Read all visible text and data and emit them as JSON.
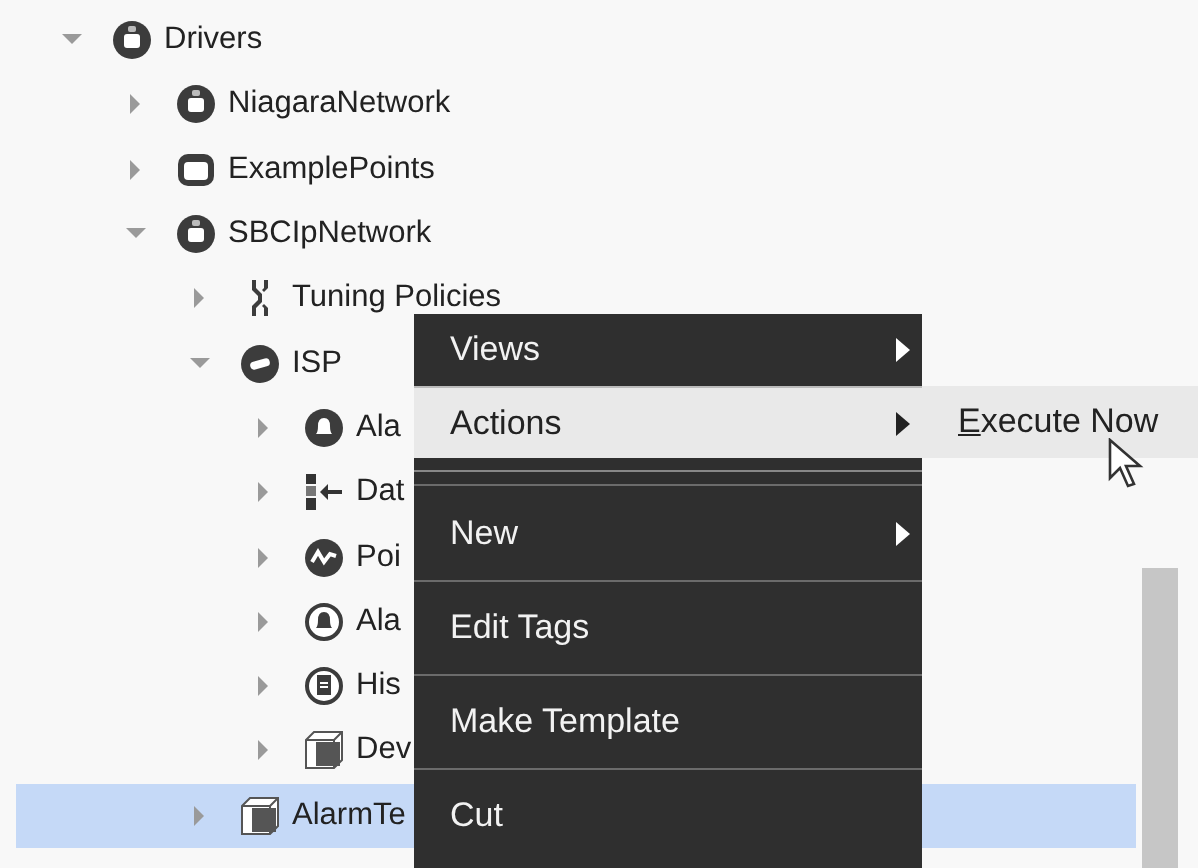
{
  "tree": [
    {
      "label": "Drivers",
      "kind": "network",
      "expanded": true,
      "selected": false,
      "children": [
        {
          "label": "NiagaraNetwork",
          "kind": "network",
          "expanded": false,
          "selected": false
        },
        {
          "label": "ExamplePoints",
          "kind": "folder",
          "expanded": false,
          "selected": false
        },
        {
          "label": "SBCIpNetwork",
          "kind": "network",
          "expanded": true,
          "selected": false,
          "children": [
            {
              "label": "Tuning Policies",
              "kind": "tuning",
              "expanded": false,
              "selected": false
            },
            {
              "label": "ISP",
              "kind": "device",
              "expanded": true,
              "selected": false,
              "children": [
                {
                  "label": "Ala",
                  "kind": "alarm-class",
                  "expanded": false,
                  "selected": false
                },
                {
                  "label": "Dat",
                  "kind": "data",
                  "expanded": false,
                  "selected": false
                },
                {
                  "label": "Poi",
                  "kind": "point",
                  "expanded": false,
                  "selected": false
                },
                {
                  "label": "Ala",
                  "kind": "alarm",
                  "expanded": false,
                  "selected": false
                },
                {
                  "label": "His",
                  "kind": "history",
                  "expanded": false,
                  "selected": false
                },
                {
                  "label": "Dev",
                  "kind": "component",
                  "expanded": false,
                  "selected": false
                }
              ]
            },
            {
              "label": "AlarmTe",
              "kind": "component",
              "expanded": false,
              "selected": true
            }
          ]
        }
      ]
    }
  ],
  "context_menu": [
    {
      "kind": "item",
      "label": "Views",
      "submenu": true,
      "selected": false
    },
    {
      "kind": "item",
      "label": "Actions",
      "submenu": true,
      "selected": true
    },
    {
      "kind": "separator"
    },
    {
      "kind": "item",
      "label": "New",
      "submenu": true,
      "selected": false
    },
    {
      "kind": "item",
      "label": "Edit Tags",
      "submenu": false,
      "selected": false
    },
    {
      "kind": "item",
      "label": "Make Template",
      "submenu": false,
      "selected": false
    },
    {
      "kind": "item",
      "label": "Cut",
      "submenu": false,
      "selected": false
    }
  ],
  "submenu": [
    {
      "mnemonic": "E",
      "rest": "xecute Now",
      "selected": true
    }
  ]
}
